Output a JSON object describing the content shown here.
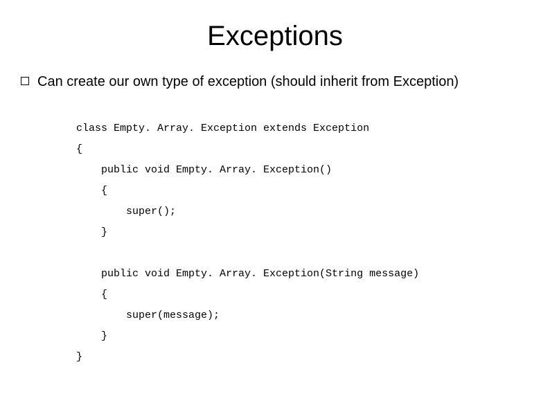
{
  "title": "Exceptions",
  "bullet": "Can create our own type of exception (should inherit from Exception)",
  "code": "class Empty. Array. Exception extends Exception\n{\n    public void Empty. Array. Exception()\n    {\n        super();\n    }\n\n    public void Empty. Array. Exception(String message)\n    {\n        super(message);\n    }\n}"
}
